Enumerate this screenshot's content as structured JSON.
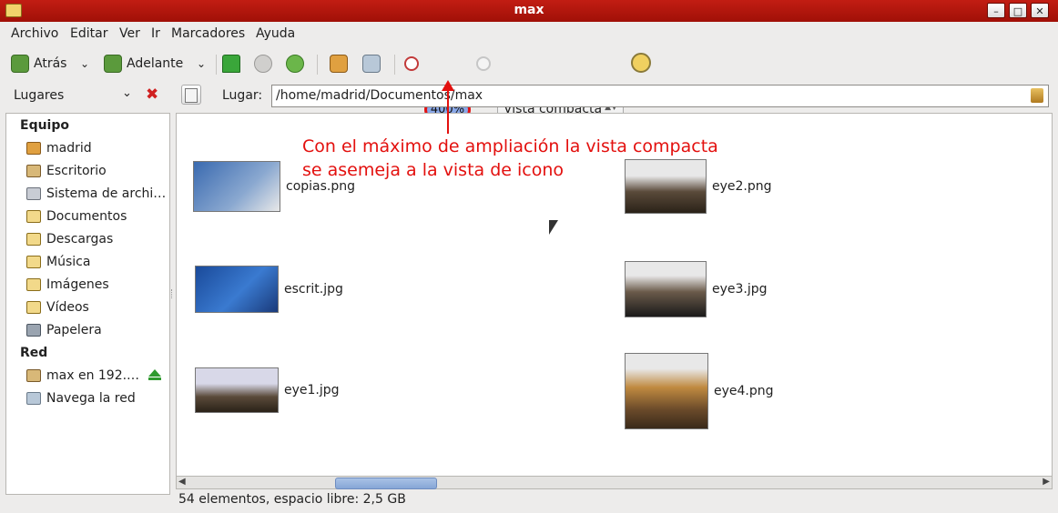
{
  "window": {
    "title": "max"
  },
  "menu": [
    "Archivo",
    "Editar",
    "Ver",
    "Ir",
    "Marcadores",
    "Ayuda"
  ],
  "toolbar": {
    "back_label": "Atrás",
    "forward_label": "Adelante",
    "zoom_level": "400%",
    "view_mode": "Vista compacta",
    "icons": [
      "back-icon",
      "forward-icon",
      "up-icon",
      "stop-icon",
      "reload-icon",
      "home-icon",
      "computer-icon",
      "zoom-out-icon",
      "zoom-in-icon",
      "search-icon"
    ]
  },
  "places": {
    "label": "Lugares",
    "location_label": "Lugar:",
    "path": "/home/madrid/Documentos/max"
  },
  "sidebar": {
    "sections": [
      {
        "title": "Equipo",
        "items": [
          "madrid",
          "Escritorio",
          "Sistema de archi…",
          "Documentos",
          "Descargas",
          "Música",
          "Imágenes",
          "Vídeos",
          "Papelera"
        ]
      },
      {
        "title": "Red",
        "items": [
          "max en 192.…",
          "Navega la red"
        ]
      }
    ]
  },
  "files": [
    "copias.png",
    "eye2.png",
    "escrit.jpg",
    "eye3.jpg",
    "eye1.jpg",
    "eye4.png"
  ],
  "annotation": {
    "line1": "Con el máximo de ampliación la vista compacta",
    "line2": "se asemeja a la vista de icono"
  },
  "status": "54 elementos, espacio libre: 2,5 GB",
  "colors": {
    "titlebar": "#b5160c",
    "annotation": "#e3100e",
    "zoom_highlight": "#8aa8e8"
  }
}
